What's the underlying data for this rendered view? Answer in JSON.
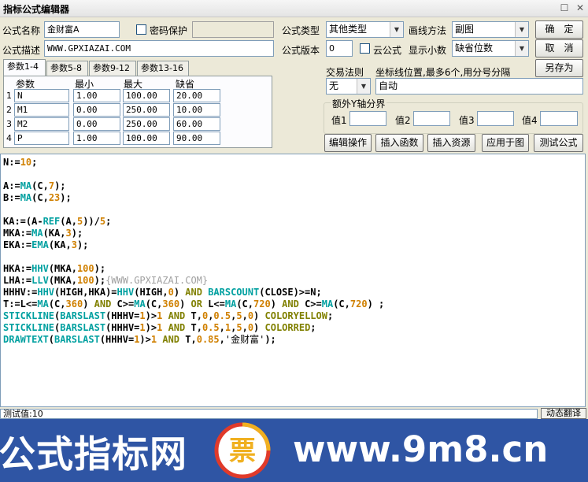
{
  "window": {
    "title": "指标公式编辑器",
    "restore_glyph": "☐",
    "close_glyph": "✕"
  },
  "form": {
    "name_label": "公式名称",
    "name_value": "金财富A",
    "password_label": "密码保护",
    "desc_label": "公式描述",
    "desc_value": "WWW.GPXIAZAI.COM",
    "type_label": "公式类型",
    "type_value": "其他类型",
    "draw_label": "画线方法",
    "draw_value": "副图",
    "version_label": "公式版本",
    "version_value": "0",
    "cloud_label": "云公式",
    "decimal_label": "显示小数",
    "decimal_value": "缺省位数"
  },
  "buttons": {
    "ok": "确　定",
    "cancel": "取　消",
    "save_as": "另存为",
    "edit_ops": "编辑操作",
    "insert_func": "插入函数",
    "insert_res": "插入资源",
    "apply_chart": "应用于图",
    "test_formula": "测试公式"
  },
  "tabs": [
    "参数1-4",
    "参数5-8",
    "参数9-12",
    "参数13-16"
  ],
  "params": {
    "headers": [
      "参数",
      "最小",
      "最大",
      "缺省"
    ],
    "rows": [
      {
        "idx": "1",
        "name": "N",
        "min": "1.00",
        "max": "100.00",
        "def": "20.00"
      },
      {
        "idx": "2",
        "name": "M1",
        "min": "0.00",
        "max": "250.00",
        "def": "10.00"
      },
      {
        "idx": "3",
        "name": "M2",
        "min": "0.00",
        "max": "250.00",
        "def": "60.00"
      },
      {
        "idx": "4",
        "name": "P",
        "min": "1.00",
        "max": "100.00",
        "def": "90.00"
      }
    ]
  },
  "trade": {
    "rule_label": "交易法则",
    "rule_value": "无",
    "coord_label": "坐标线位置,最多6个,用分号分隔",
    "coord_value": "自动",
    "yaxis_title": "额外Y轴分界",
    "y_labels": [
      "值1",
      "值2",
      "值3",
      "值4"
    ]
  },
  "code_lines": [
    "N:=10;",
    "",
    "A:=MA(C,7);",
    "B:=MA(C,23);",
    "",
    "KA:=(A-REF(A,5))/5;",
    "MKA:=MA(KA,3);",
    "EKA:=EMA(KA,3);",
    "",
    "HKA:=HHV(MKA,100);",
    "LHA:=LLV(MKA,100);{WWW.GPXIAZAI.COM}",
    "HHHV:=HHV(HIGH,HKA)=HHV(HIGH,0) AND BARSCOUNT(CLOSE)>=N;",
    "T:=L<=MA(C,360) AND C>=MA(C,360) OR L<=MA(C,720) AND C>=MA(C,720) ;",
    "STICKLINE(BARSLAST(HHHV=1)>1 AND T,0,0.5,5,0) COLORYELLOW;",
    "STICKLINE(BARSLAST(HHHV=1)>1 AND T,0.5,1,5,0) COLORRED;",
    "DRAWTEXT(BARSLAST(HHHV=1)>1 AND T,0.85,'金财富');"
  ],
  "status": {
    "text": "测试值:10",
    "button": "动态翻译"
  },
  "banner": {
    "left": "公式指标网",
    "right": "www.9m8.cn",
    "logo_char": "票"
  },
  "colors": {
    "function": "#00a0a0",
    "number": "#d08000",
    "keyword": "#808000",
    "banner_bg": "#2f55a4"
  }
}
